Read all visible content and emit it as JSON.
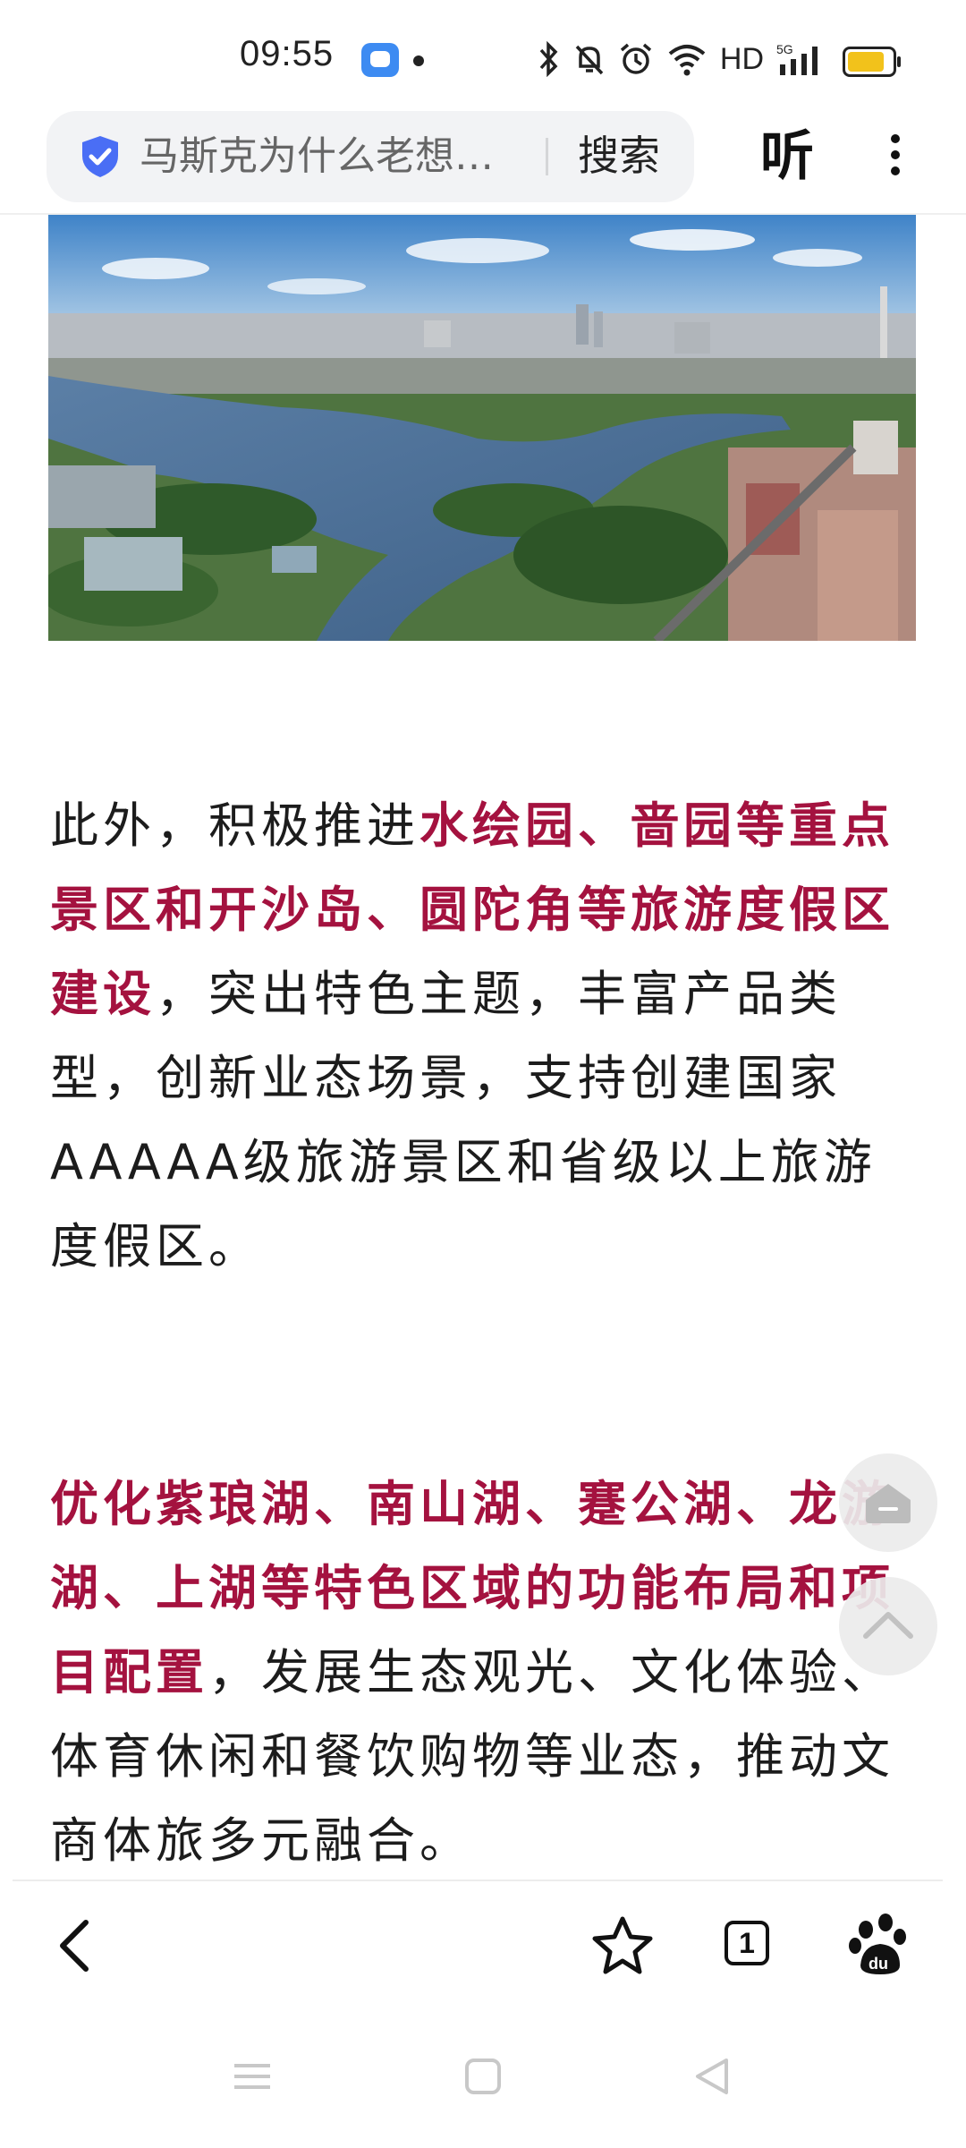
{
  "status_bar": {
    "time": "09:55",
    "network": "HD"
  },
  "search": {
    "query": "马斯克为什么老想…",
    "button_label": "搜索",
    "icon": "shield-check-icon"
  },
  "header": {
    "listen_label": "听",
    "more_icon": "more-vertical-icon"
  },
  "article": {
    "image_alt": "city-lake-aerial-photo",
    "paragraph1": {
      "before": "此外，积极推进",
      "highlight": "水绘园、啬园等重点景区和开沙岛、圆陀角等旅游度假区建设",
      "after": "，突出特色主题，丰富产品类型，创新业态场景，支持创建国家AAAAA级旅游景区和省级以上旅游度假区。"
    },
    "paragraph2": {
      "highlight": "优化紫琅湖、南山湖、蹇公湖、龙游湖、上湖等特色区域的功能布局和项目配置",
      "after": "，发展生态观光、文化体验、体育休闲和餐饮购物等业态，推动文商体旅多元融合。"
    }
  },
  "floating": {
    "home_icon": "home-icon",
    "top_icon": "back-to-top-icon"
  },
  "toolbar": {
    "back_icon": "chevron-left-icon",
    "favorite_icon": "star-icon",
    "tab_count": "1",
    "baidu_icon": "baidu-paw-icon"
  },
  "colors": {
    "highlight": "#a4123f",
    "battery": "#f2c21b",
    "shield": "#4a6ef5"
  }
}
